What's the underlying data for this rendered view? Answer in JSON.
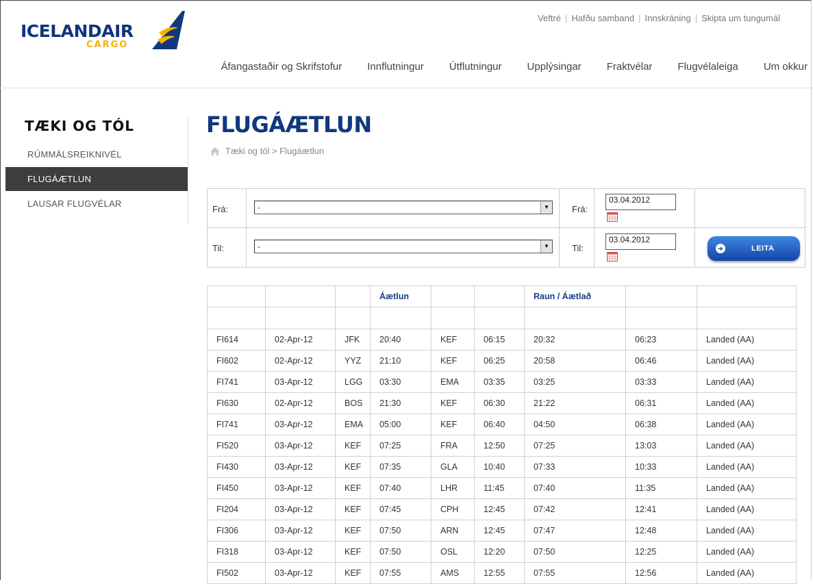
{
  "brand": {
    "name": "ICELANDAIR",
    "sub": "CARGO"
  },
  "util_links": [
    "Veftré",
    "Hafðu samband",
    "Innskráning",
    "Skipta um tungumál"
  ],
  "nav": [
    "Áfangastaðir og Skrifstofur",
    "Innflutningur",
    "Útflutningur",
    "Upplýsingar",
    "Fraktvélar",
    "Flugvélaleiga",
    "Um okkur"
  ],
  "sidebar": {
    "title": "TÆKI OG TÓL",
    "items": [
      {
        "label": "RÚMMÁLSREIKNIVÉL",
        "active": false
      },
      {
        "label": "FLUGÁÆTLUN",
        "active": true
      },
      {
        "label": "LAUSAR FLUGVÉLAR",
        "active": false
      }
    ]
  },
  "page": {
    "title": "FLUGÁÆTLUN",
    "breadcrumb": "Tæki og tól > Flugáætlun"
  },
  "search": {
    "from_label": "Frá:",
    "to_label": "Til:",
    "from_value": "-",
    "to_value": "-",
    "date_from_label": "Frá:",
    "date_to_label": "Til:",
    "date_from": "03.04.2012",
    "date_to": "03.04.2012",
    "button": "LEITA"
  },
  "table": {
    "headers": [
      "",
      "",
      "",
      "Áætlun",
      "",
      "",
      "Raun / Áætlað",
      "",
      ""
    ],
    "rows": [
      [
        "FI614",
        "02-Apr-12",
        "JFK",
        "20:40",
        "KEF",
        "06:15",
        "20:32",
        "06:23",
        "Landed (AA)"
      ],
      [
        "FI602",
        "02-Apr-12",
        "YYZ",
        "21:10",
        "KEF",
        "06:25",
        "20:58",
        "06:46",
        "Landed (AA)"
      ],
      [
        "FI741",
        "03-Apr-12",
        "LGG",
        "03:30",
        "EMA",
        "03:35",
        "03:25",
        "03:33",
        "Landed (AA)"
      ],
      [
        "FI630",
        "02-Apr-12",
        "BOS",
        "21:30",
        "KEF",
        "06:30",
        "21:22",
        "06:31",
        "Landed (AA)"
      ],
      [
        "FI741",
        "03-Apr-12",
        "EMA",
        "05:00",
        "KEF",
        "06:40",
        "04:50",
        "06:38",
        "Landed (AA)"
      ],
      [
        "FI520",
        "03-Apr-12",
        "KEF",
        "07:25",
        "FRA",
        "12:50",
        "07:25",
        "13:03",
        "Landed (AA)"
      ],
      [
        "FI430",
        "03-Apr-12",
        "KEF",
        "07:35",
        "GLA",
        "10:40",
        "07:33",
        "10:33",
        "Landed (AA)"
      ],
      [
        "FI450",
        "03-Apr-12",
        "KEF",
        "07:40",
        "LHR",
        "11:45",
        "07:40",
        "11:35",
        "Landed (AA)"
      ],
      [
        "FI204",
        "03-Apr-12",
        "KEF",
        "07:45",
        "CPH",
        "12:45",
        "07:42",
        "12:41",
        "Landed (AA)"
      ],
      [
        "FI306",
        "03-Apr-12",
        "KEF",
        "07:50",
        "ARN",
        "12:45",
        "07:47",
        "12:48",
        "Landed (AA)"
      ],
      [
        "FI318",
        "03-Apr-12",
        "KEF",
        "07:50",
        "OSL",
        "12:20",
        "07:50",
        "12:25",
        "Landed (AA)"
      ],
      [
        "FI502",
        "03-Apr-12",
        "KEF",
        "07:55",
        "AMS",
        "12:55",
        "07:55",
        "12:56",
        "Landed (AA)"
      ]
    ]
  },
  "colors": {
    "brand_blue": "#12387e",
    "brand_yellow": "#f4b400",
    "active_bg": "#3d3d3d"
  }
}
